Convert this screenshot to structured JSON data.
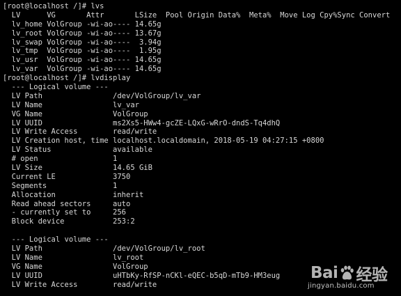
{
  "terminal": {
    "lines": [
      "[root@localhost /]# lvs",
      "  LV      VG       Attr       LSize  Pool Origin Data%  Meta%  Move Log Cpy%Sync Convert",
      "  lv_home VolGroup -wi-ao---- 14.65g",
      "  lv_root VolGroup -wi-ao---- 13.67g",
      "  lv_swap VolGroup -wi-ao----  3.94g",
      "  lv_tmp  VolGroup -wi-ao----  1.95g",
      "  lv_usr  VolGroup -wi-ao---- 14.65g",
      "  lv_var  VolGroup -wi-ao---- 14.65g",
      "[root@localhost /]# lvdisplay",
      "  --- Logical volume ---",
      "  LV Path                /dev/VolGroup/lv_var",
      "  LV Name                lv_var",
      "  VG Name                VolGroup",
      "  LV UUID                ms2Xs5-HWw4-gcZE-LQxG-wRrO-dndS-Tq4dhQ",
      "  LV Write Access        read/write",
      "  LV Creation host, time localhost.localdomain, 2018-05-19 04:27:15 +0800",
      "  LV Status              available",
      "  # open                 1",
      "  LV Size                14.65 GiB",
      "  Current LE             3750",
      "  Segments               1",
      "  Allocation             inherit",
      "  Read ahead sectors     auto",
      "  - currently set to     256",
      "  Block device           253:2",
      "",
      "  --- Logical volume ---",
      "  LV Path                /dev/VolGroup/lv_root",
      "  LV Name                lv_root",
      "  VG Name                VolGroup",
      "  LV UUID                uHTbKy-RfSP-nCKl-eQEC-b5qD-mTb9-HM3eug",
      "  LV Write Access        read/write"
    ]
  },
  "watermark": {
    "brand_left": "Bai",
    "brand_right": "经验",
    "url": "jingyan.baidu.com",
    "paw_icon": "baidu-paw-icon"
  }
}
